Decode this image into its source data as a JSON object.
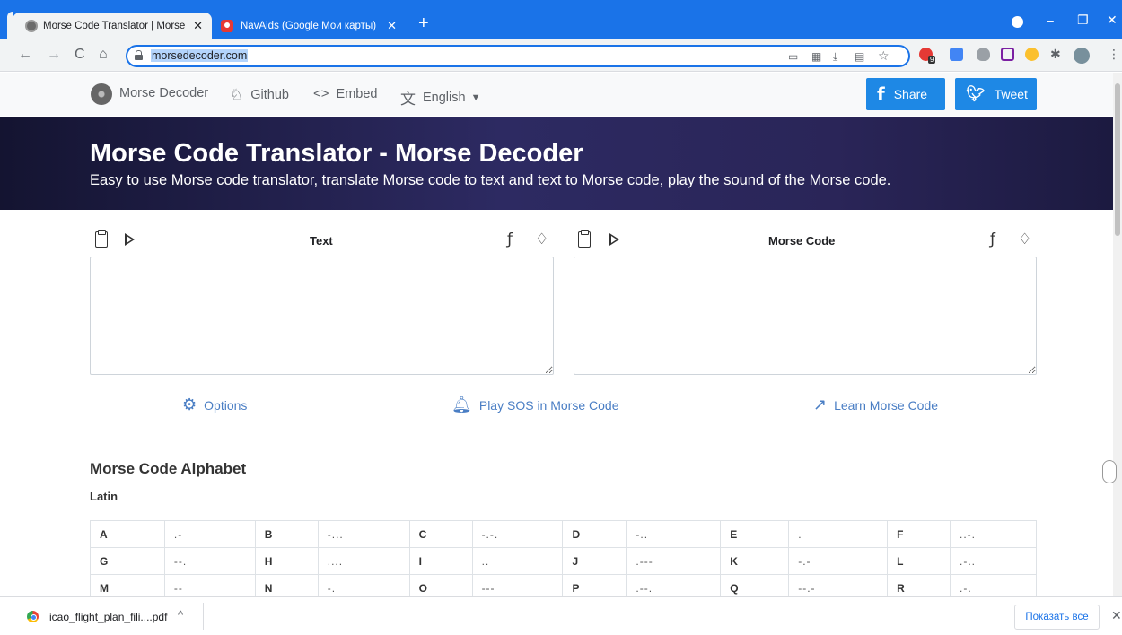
{
  "browser": {
    "tabs": [
      {
        "title": "Morse Code Translator | Morse D",
        "close": "✕"
      },
      {
        "title": "NavAids (Google Мои карты)",
        "close": "✕"
      }
    ],
    "new_tab": "+",
    "url": "morsedecoder.com",
    "window_controls": {
      "minimize": "–",
      "restore": "❐",
      "close": "✕"
    },
    "extension_badge": "9",
    "icon_names": [
      "back-icon",
      "forward-icon",
      "reload-icon",
      "home-icon",
      "lock-icon",
      "star-icon",
      "puzzle-icon",
      "kebab-menu-icon"
    ]
  },
  "site_nav": {
    "brand": "Morse Decoder",
    "github": "Github",
    "embed": "Embed",
    "language": "English",
    "share_label": "Share",
    "tweet_label": "Tweet",
    "colors": {
      "share": "#1e88e5",
      "tweet": "#1e88e5"
    }
  },
  "hero": {
    "title": "Morse Code Translator - Morse Decoder",
    "subtitle": "Easy to use Morse code translator, translate Morse code to text and text to Morse code, play the sound of the Morse code."
  },
  "translator": {
    "left_title": "Text",
    "right_title": "Morse Code",
    "left_value": "",
    "right_value": "",
    "actions": {
      "options": "Options",
      "play_sos": "Play SOS in Morse Code",
      "learn": "Learn Morse Code"
    },
    "accent": "#4a7ec4"
  },
  "alphabet": {
    "title": "Morse Code Alphabet",
    "subtitle": "Latin",
    "rows": [
      [
        {
          "l": "A",
          "c": ".-"
        },
        {
          "l": "B",
          "c": "-..."
        },
        {
          "l": "C",
          "c": "-.-."
        },
        {
          "l": "D",
          "c": "-.."
        },
        {
          "l": "E",
          "c": "."
        },
        {
          "l": "F",
          "c": "..-."
        }
      ],
      [
        {
          "l": "G",
          "c": "--."
        },
        {
          "l": "H",
          "c": "...."
        },
        {
          "l": "I",
          "c": ".."
        },
        {
          "l": "J",
          "c": ".---"
        },
        {
          "l": "K",
          "c": "-.-"
        },
        {
          "l": "L",
          "c": ".-.."
        }
      ],
      [
        {
          "l": "M",
          "c": "--"
        },
        {
          "l": "N",
          "c": "-."
        },
        {
          "l": "O",
          "c": "---"
        },
        {
          "l": "P",
          "c": ".--."
        },
        {
          "l": "Q",
          "c": "--.-"
        },
        {
          "l": "R",
          "c": ".-."
        }
      ]
    ]
  },
  "download_bar": {
    "file_name": "icao_flight_plan_fili....pdf",
    "chevron": "^",
    "show_all": "Показать все",
    "close": "✕"
  }
}
